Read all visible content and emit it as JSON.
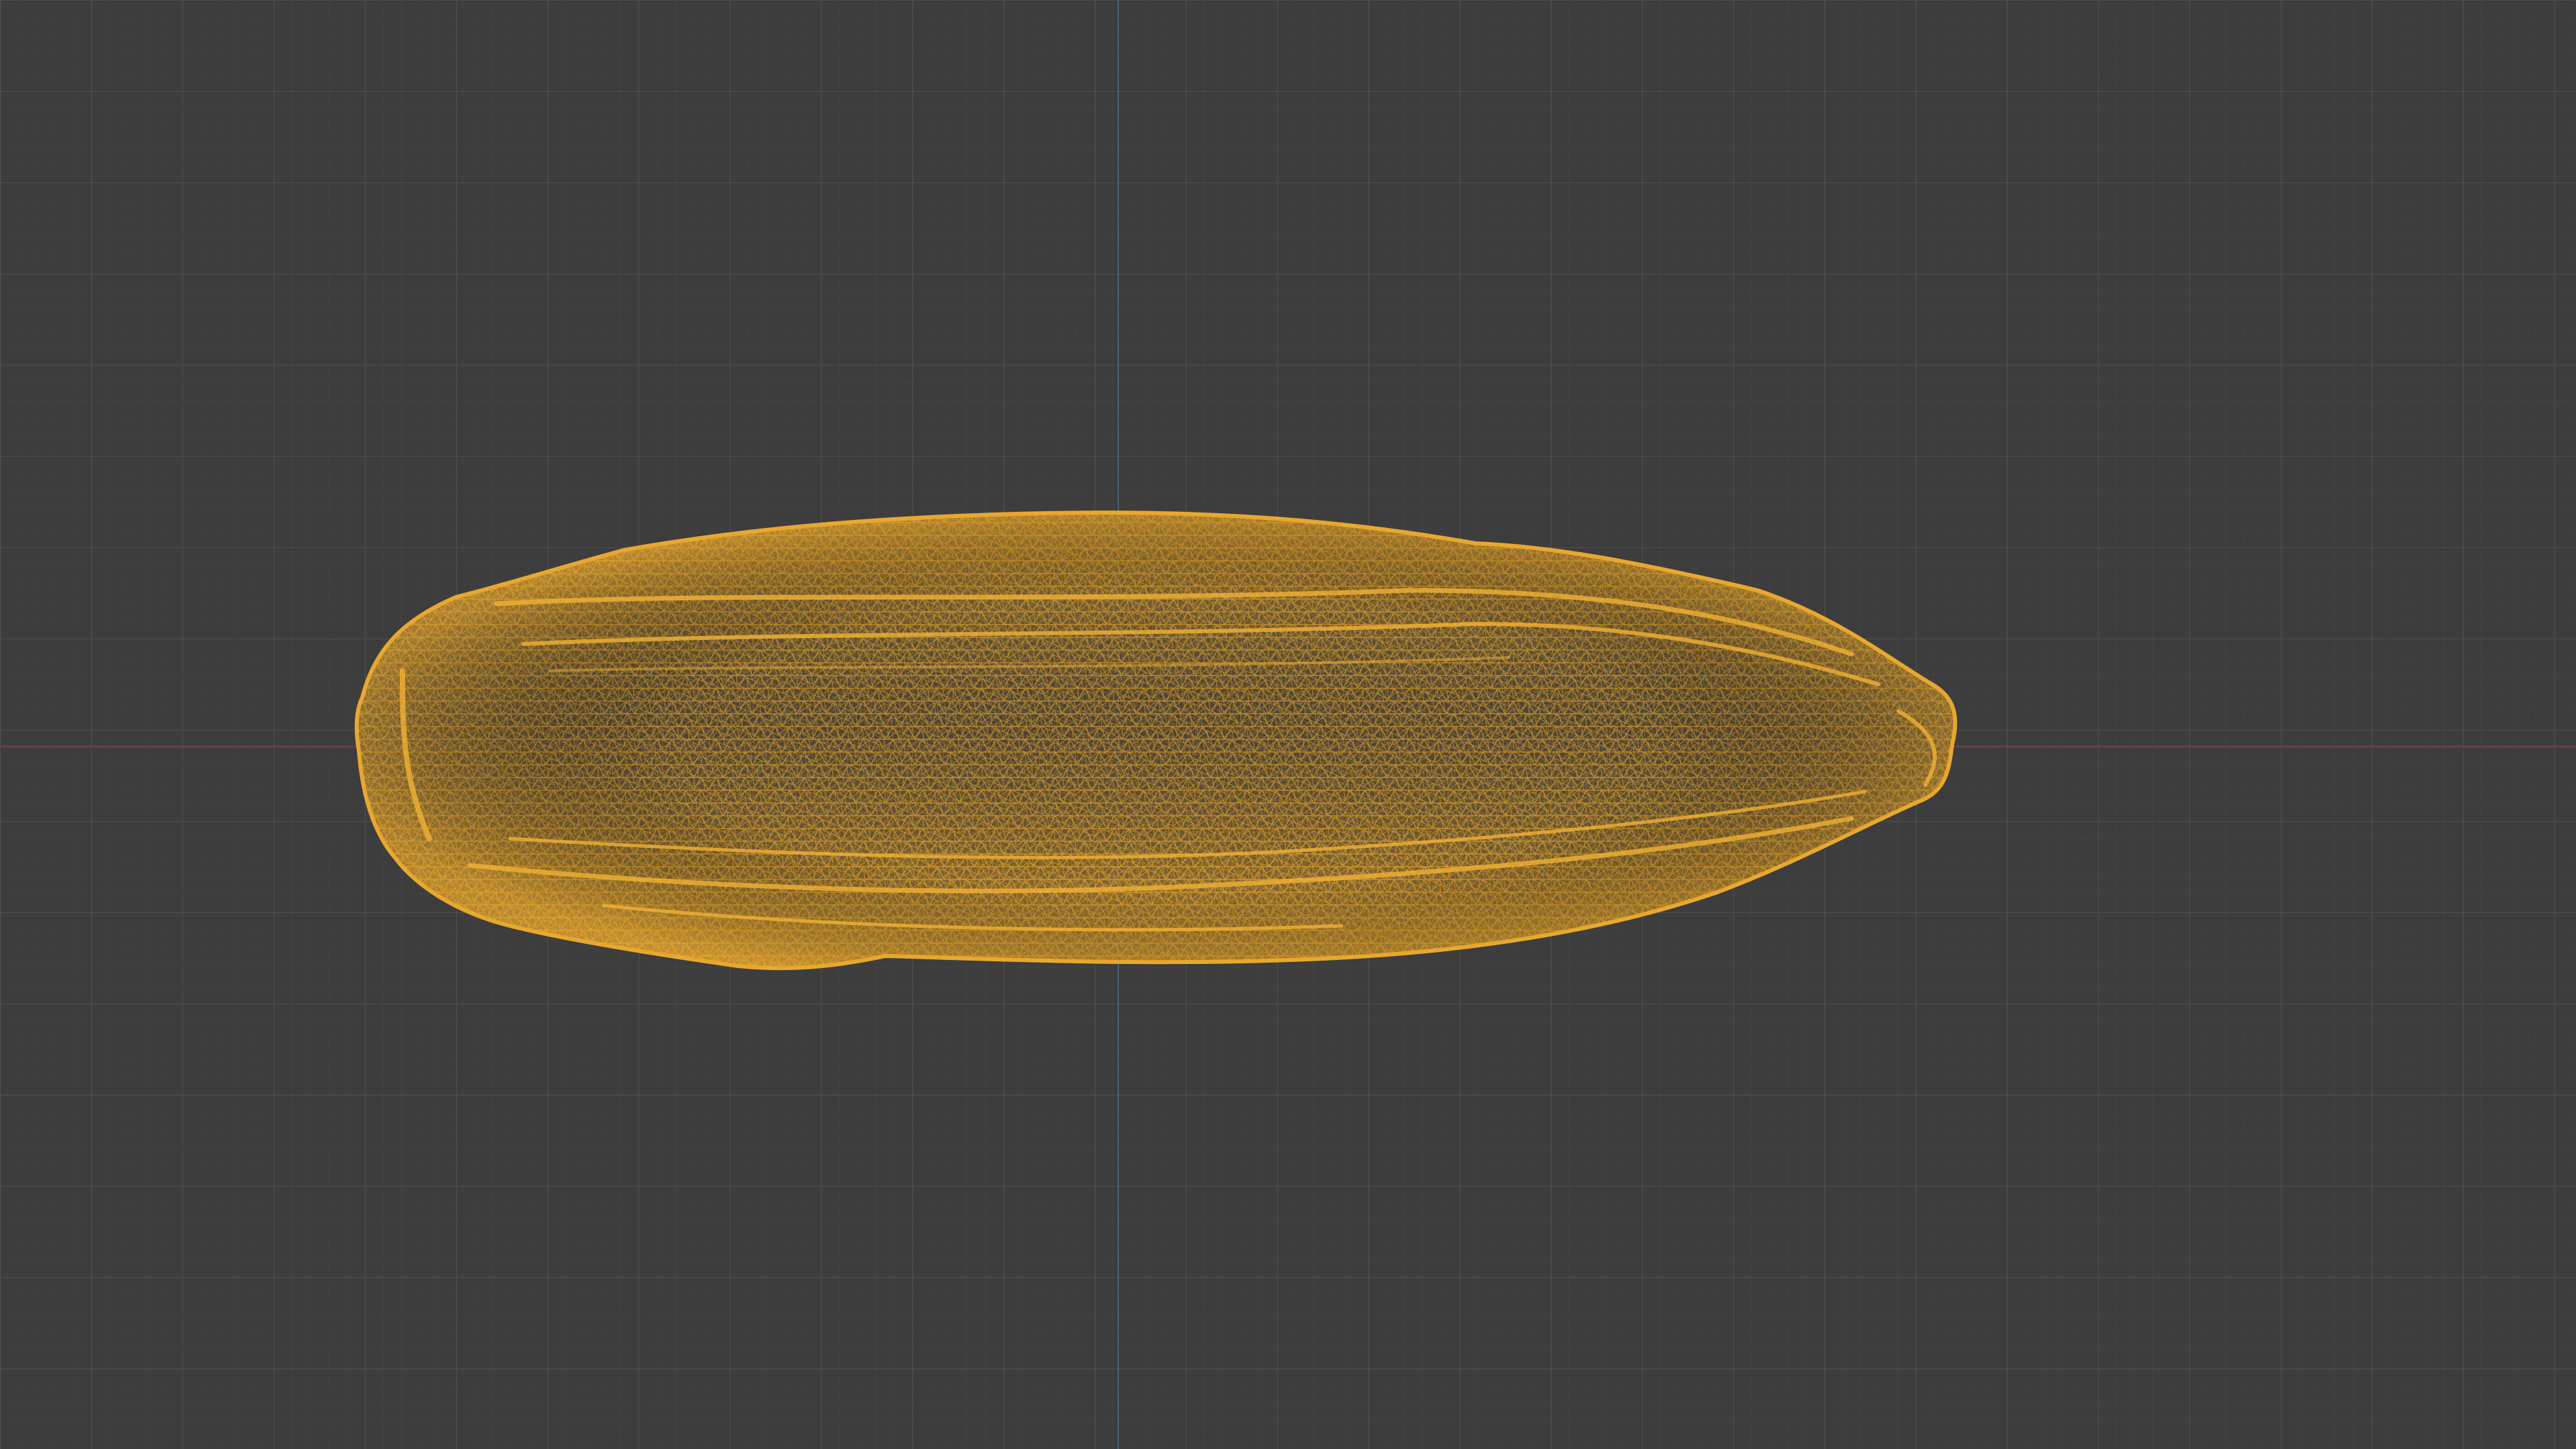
{
  "viewport": {
    "background_color": "#3d3d3d",
    "grid": true,
    "axis_x_color": "#7a4a4a",
    "axis_y_color": "#4f6d8f"
  },
  "object": {
    "display_mode": "wireframe",
    "selected": true,
    "wire_color": "#e0a12a",
    "fill_color": "#7a6232"
  }
}
